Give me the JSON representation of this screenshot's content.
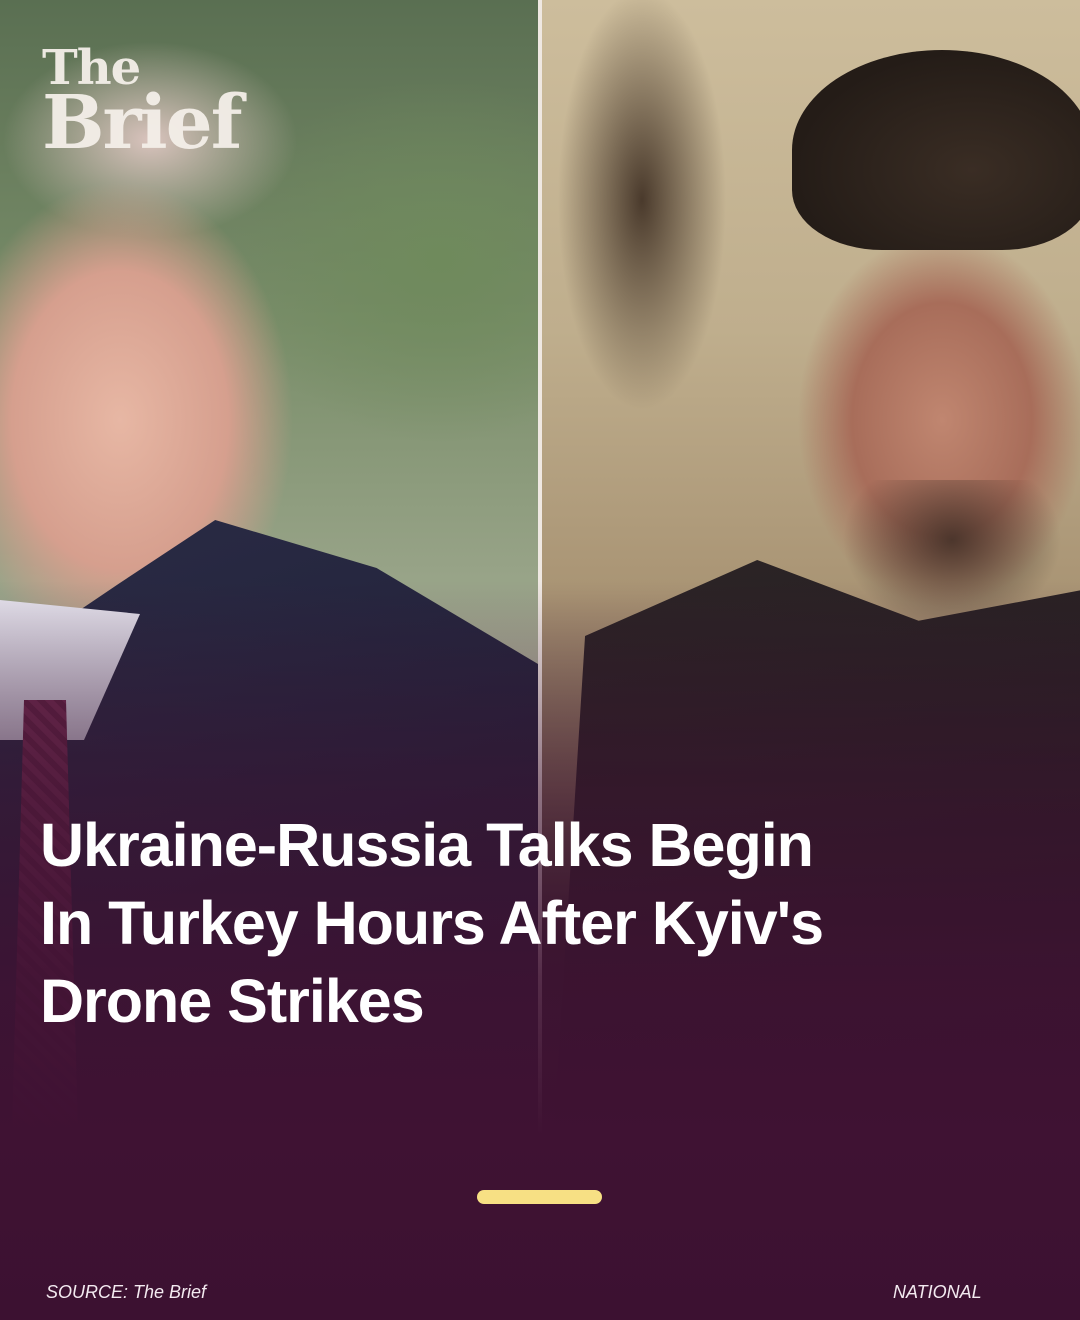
{
  "brand": {
    "line1": "The",
    "line2": "Brief"
  },
  "headline": {
    "line1": "Ukraine-Russia Talks Begin",
    "line2": "In Turkey Hours After Kyiv's",
    "line3": "Drone Strikes"
  },
  "footer": {
    "source": "SOURCE: The Brief",
    "category": "NATIONAL"
  },
  "carousel": {
    "active_index": 1,
    "count": 1
  },
  "colors": {
    "background": "#3f1233",
    "headline_text": "#ffffff",
    "indicator": "#f7e084",
    "divider": "#efe8e2"
  }
}
